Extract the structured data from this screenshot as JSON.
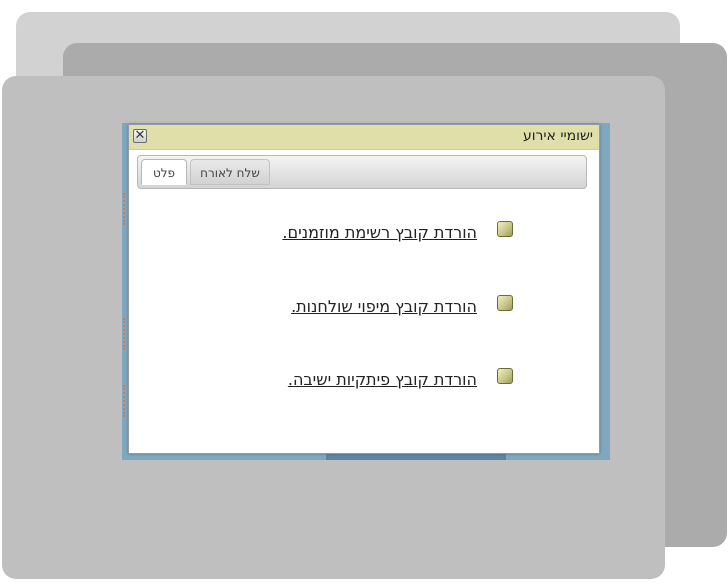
{
  "dialog": {
    "title": "ישומיי אירוע",
    "close_label": "✕"
  },
  "tabs": [
    {
      "label": "פלט",
      "active": true
    },
    {
      "label": "שלח לאורח",
      "active": false
    }
  ],
  "downloads": [
    {
      "label": "הורדת קובץ רשימת מוזמנים."
    },
    {
      "label": "הורדת קובץ מיפוי שולחנות."
    },
    {
      "label": "הורדת קובץ פיתקיות ישיבה."
    }
  ],
  "colors": {
    "titlebar": "#e1dfa9",
    "backdrop": "#7fa8bf",
    "bullet": "#c9c78a"
  }
}
